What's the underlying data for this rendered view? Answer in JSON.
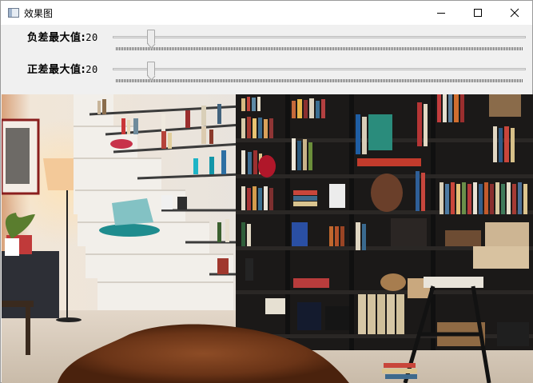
{
  "window": {
    "title": "效果图",
    "icon": "app-window-icon",
    "buttons": [
      "minimize-icon",
      "maximize-icon",
      "close-icon"
    ]
  },
  "controls": [
    {
      "label": "负差最大值",
      "value": "20",
      "fraction": 0.085
    },
    {
      "label": "正差最大值",
      "value": "20",
      "fraction": 0.085
    }
  ],
  "image": {
    "description_icon": "result-image",
    "colors": {
      "shelf": "#1b1918",
      "wall": "#e9e4dc",
      "floor": "#d7cbbd",
      "rug": "#7a3f1f",
      "lamp": "#f3c999"
    }
  }
}
